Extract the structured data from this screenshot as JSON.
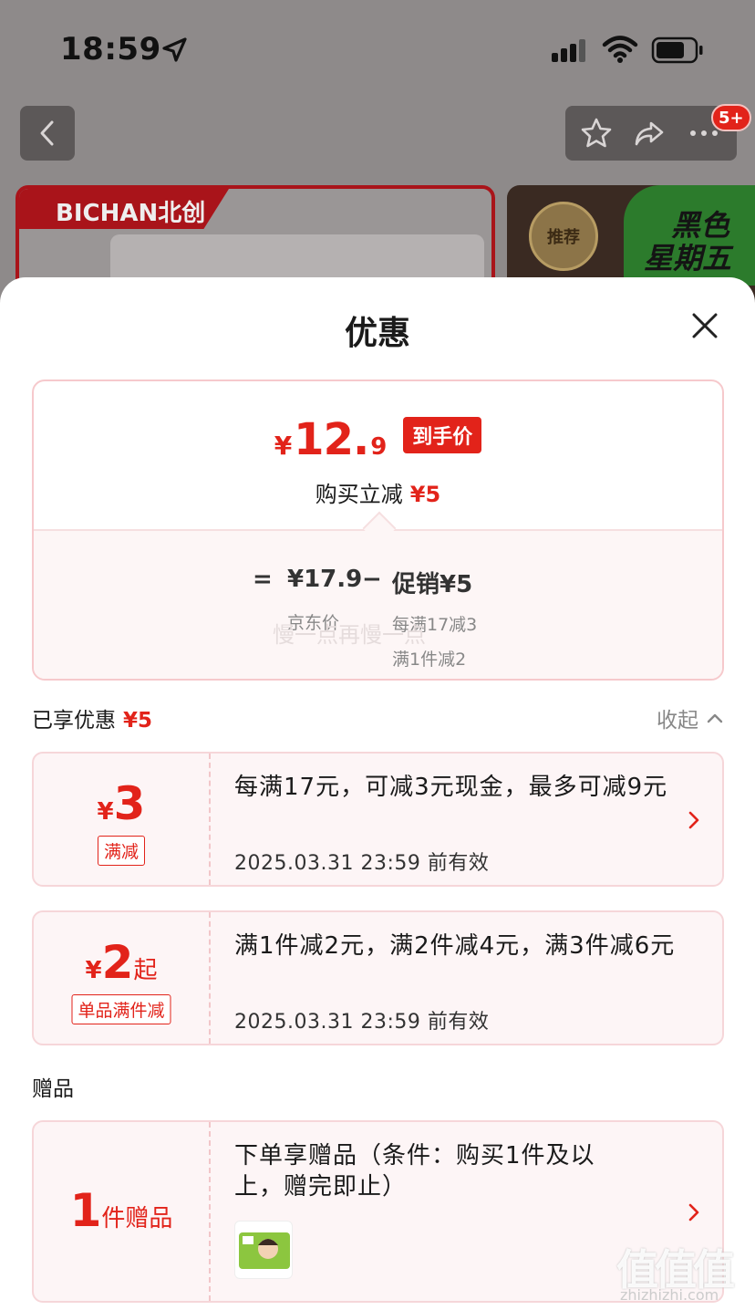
{
  "status_bar": {
    "time": "18:59"
  },
  "background_page": {
    "notification_badge": "5+",
    "brand_label": "BICHAN北创",
    "recommend_seal": "推荐",
    "promo_tag_line1": "黑色",
    "promo_tag_line2": "星期五"
  },
  "sheet": {
    "title": "优惠",
    "summary": {
      "price_symbol": "¥",
      "price_integer": "12.",
      "price_decimal": "9",
      "price_tag": "到手价",
      "saving_label": "购买立减",
      "saving_value": "¥5",
      "equals": "=",
      "jd_price": "¥17.9",
      "jd_price_label": "京东价",
      "minus": "−",
      "promo_label": "促销¥5",
      "promo_detail_1": "每满17减3",
      "promo_detail_2": "满1件减2",
      "watermark": "慢一点再慢一点"
    },
    "applied": {
      "label": "已享优惠",
      "value": "¥5",
      "collapse_label": "收起"
    },
    "coupons": [
      {
        "yen": "¥",
        "amount": "3",
        "suffix": "",
        "tag": "满减",
        "desc": "每满17元，可减3元现金，最多可减9元",
        "date": "2025.03.31 23:59 前有效"
      },
      {
        "yen": "¥",
        "amount": "2",
        "suffix": "起",
        "tag": "单品满件减",
        "desc": "满1件减2元，满2件减4元，满3件减6元",
        "date": "2025.03.31 23:59 前有效"
      }
    ],
    "gift_section": {
      "label": "赠品",
      "amount": "1",
      "suffix": "件赠品",
      "desc": "下单享赠品（条件：购买1件及以上，赠完即止）"
    }
  },
  "site_watermark": {
    "big": "值值值",
    "small": "zhizhizhi.com"
  },
  "colors": {
    "accent": "#e2231a",
    "coupon_bg": "#fdf5f6",
    "border_pink": "#f6c9cc"
  }
}
